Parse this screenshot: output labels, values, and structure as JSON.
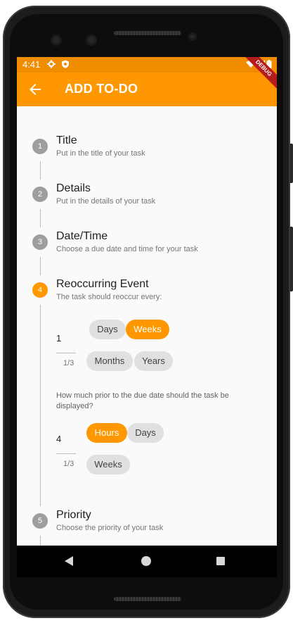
{
  "status_bar": {
    "time": "4:41"
  },
  "app_bar": {
    "title": "ADD TO-DO",
    "debug_banner": "DEBUG"
  },
  "steps": [
    {
      "number": "1",
      "title": "Title",
      "subtitle": "Put in the title of your task"
    },
    {
      "number": "2",
      "title": "Details",
      "subtitle": "Put in the details of your task"
    },
    {
      "number": "3",
      "title": "Date/Time",
      "subtitle": "Choose a due date and time for your task"
    },
    {
      "number": "4",
      "title": "Reoccurring Event",
      "subtitle": "The task should reoccur every:"
    },
    {
      "number": "5",
      "title": "Priority",
      "subtitle": "Choose the priority of your task"
    }
  ],
  "recurrence": {
    "value": "1",
    "counter": "1/3",
    "chips": [
      "Days",
      "Weeks",
      "Months",
      "Years"
    ],
    "selected": "Weeks"
  },
  "prior_display": {
    "question": "How much prior to the due date should the task be displayed?",
    "value": "4",
    "counter": "1/3",
    "chips": [
      "Hours",
      "Days",
      "Weeks"
    ],
    "selected": "Hours"
  },
  "colors": {
    "accent": "#ff9800",
    "status_bar": "#f08c00",
    "inactive_step": "#9e9e9e",
    "chip": "#e0e0e0"
  }
}
